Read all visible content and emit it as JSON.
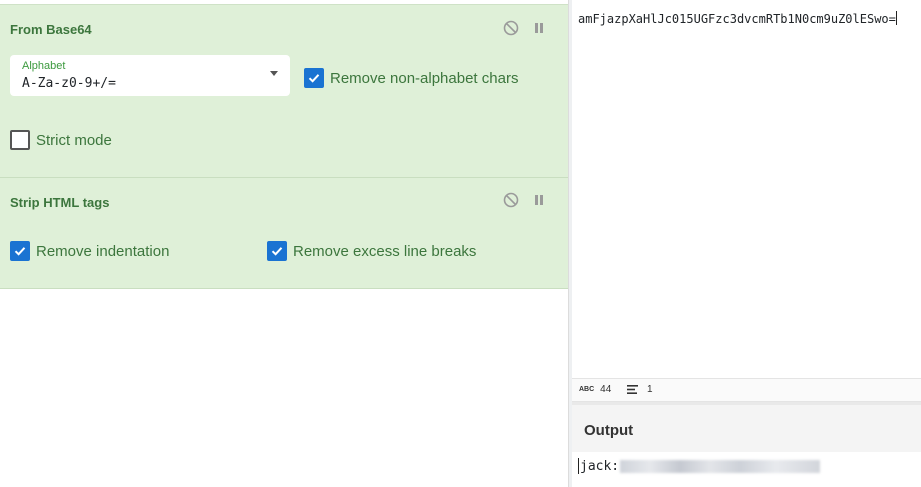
{
  "recipe": {
    "operations": [
      {
        "title": "From Base64",
        "alphabet": {
          "label": "Alphabet",
          "value": "A-Za-z0-9+/="
        },
        "remove_non_alphabet": {
          "label": "Remove non-alphabet chars",
          "checked": true
        },
        "strict_mode": {
          "label": "Strict mode",
          "checked": false
        }
      },
      {
        "title": "Strip HTML tags",
        "remove_indentation": {
          "label": "Remove indentation",
          "checked": true
        },
        "remove_line_breaks": {
          "label": "Remove excess line breaks",
          "checked": true
        }
      }
    ]
  },
  "input": {
    "text": "amFjazpXaHlJc015UGFzc3dvcmRTb1N0cm9uZ0lESwo=",
    "stats": {
      "length": "44",
      "lines": "1"
    }
  },
  "output": {
    "title": "Output",
    "text_visible": "jack:",
    "text_redacted": true
  },
  "colors": {
    "operation_bg": "#dff0d8",
    "operation_title": "#3c763d",
    "checkbox_checked": "#1a73d2"
  },
  "icons": [
    "disable-icon",
    "pause-icon",
    "dropdown-caret-icon",
    "checkmark-icon",
    "abc-icon",
    "lines-icon"
  ]
}
